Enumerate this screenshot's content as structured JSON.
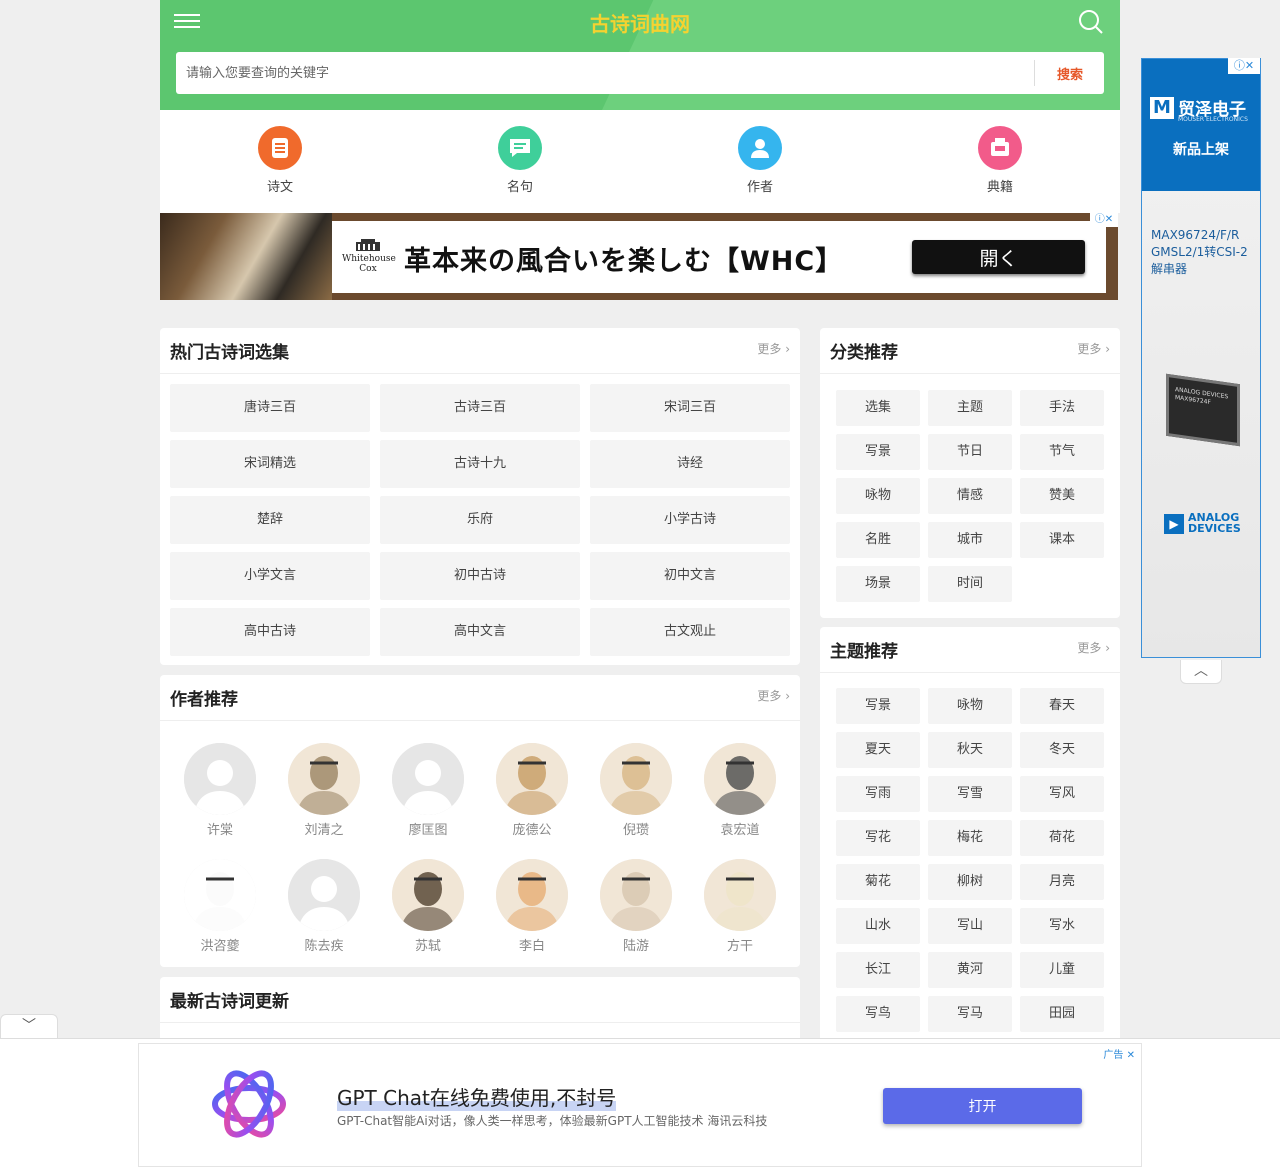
{
  "header": {
    "title": "古诗词曲网",
    "search_placeholder": "请输入您要查询的关键字",
    "search_button": "搜索"
  },
  "nav": [
    {
      "label": "诗文",
      "icon": "document-icon",
      "color": "#f06a2c"
    },
    {
      "label": "名句",
      "icon": "chat-icon",
      "color": "#3fcf9a"
    },
    {
      "label": "作者",
      "icon": "person-icon",
      "color": "#35b5ee"
    },
    {
      "label": "典籍",
      "icon": "book-icon",
      "color": "#f25b8a"
    }
  ],
  "top_ad": {
    "brand": "Whitehouse Cox",
    "headline": "革本来の風合いを楽しむ【WHC】",
    "button": "開く"
  },
  "anthologies": {
    "title": "热门古诗词选集",
    "more": "更多",
    "items": [
      "唐诗三百",
      "古诗三百",
      "宋词三百",
      "宋词精选",
      "古诗十九",
      "诗经",
      "楚辞",
      "乐府",
      "小学古诗",
      "小学文言",
      "初中古诗",
      "初中文言",
      "高中古诗",
      "高中文言",
      "古文观止"
    ]
  },
  "categories": {
    "title": "分类推荐",
    "more": "更多",
    "items": [
      "选集",
      "主题",
      "手法",
      "写景",
      "节日",
      "节气",
      "咏物",
      "情感",
      "赞美",
      "名胜",
      "城市",
      "课本",
      "场景",
      "时间"
    ]
  },
  "authors": {
    "title": "作者推荐",
    "more": "更多",
    "items": [
      "许棠",
      "刘清之",
      "廖匡图",
      "庞德公",
      "倪瓒",
      "袁宏道",
      "洪咨夔",
      "陈去疾",
      "苏轼",
      "李白",
      "陆游",
      "方干"
    ]
  },
  "themes": {
    "title": "主题推荐",
    "more": "更多",
    "items": [
      "写景",
      "咏物",
      "春天",
      "夏天",
      "秋天",
      "冬天",
      "写雨",
      "写雪",
      "写风",
      "写花",
      "梅花",
      "荷花",
      "菊花",
      "柳树",
      "月亮",
      "山水",
      "写山",
      "写水",
      "长江",
      "黄河",
      "儿童",
      "写鸟",
      "写马",
      "田园"
    ]
  },
  "latest": {
    "title": "最新古诗词更新"
  },
  "side_ad": {
    "brand_cn": "贸泽电子",
    "brand_en": "MOUSER ELECTRONICS",
    "tagline": "新品上架",
    "part": "MAX96724/F/R GMSL2/1转CSI-2解串器",
    "chip_label": "ANALOG DEVICES MAX96724F",
    "maker": "ANALOG DEVICES"
  },
  "bottom_ad": {
    "title": "GPT Chat在线免费使用,不封号",
    "desc": "GPT-Chat智能Ai对话，像人类一样思考，体验最新GPT人工智能技术 海讯云科技",
    "button": "打开",
    "ad_label": "广告"
  }
}
